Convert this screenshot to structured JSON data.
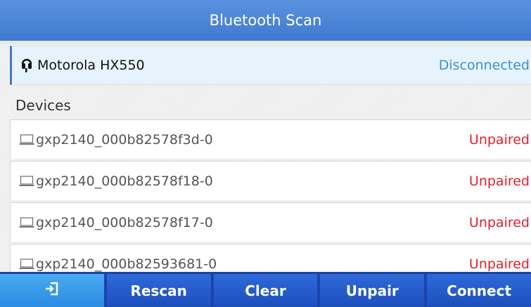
{
  "title": "Bluetooth Scan",
  "headset": {
    "name": "Motorola HX550",
    "status": "Disconnected",
    "icon": "headset-icon"
  },
  "section": {
    "title": "Devices"
  },
  "devices": [
    {
      "name": "gxp2140_000b82578f3d-0",
      "status": "Unpaired",
      "icon": "laptop-icon"
    },
    {
      "name": "gxp2140_000b82578f18-0",
      "status": "Unpaired",
      "icon": "laptop-icon"
    },
    {
      "name": "gxp2140_000b82578f17-0",
      "status": "Unpaired",
      "icon": "laptop-icon"
    },
    {
      "name": "gxp2140_000b82593681-0",
      "status": "Unpaired",
      "icon": "laptop-icon"
    }
  ],
  "toolbar": {
    "back_icon": "exit-icon",
    "rescan": "Rescan",
    "clear": "Clear",
    "unpair": "Unpair",
    "connect": "Connect"
  },
  "colors": {
    "accent": "#3f79d0",
    "disconnected": "#3b8fd6",
    "unpaired": "#e2202a",
    "toolbar": "#1d4fbf"
  }
}
